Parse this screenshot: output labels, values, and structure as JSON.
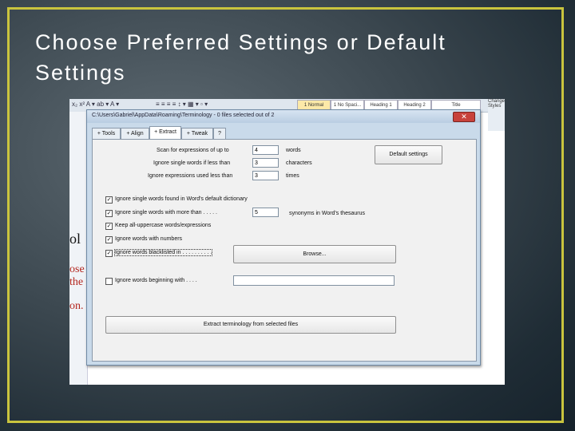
{
  "slide": {
    "title": "Choose Preferred Settings or Default Settings"
  },
  "colors": {
    "frame": "#c9c43e",
    "close": "#c8413b"
  },
  "ribbon": {
    "styles": [
      "1 Normal",
      "1 No Spaci...",
      "Heading 1",
      "Heading 2",
      "Title"
    ],
    "change_styles": "Change Styles"
  },
  "doc": {
    "fragment1": "ol",
    "fragment2": "ose",
    "fragment3": "the",
    "fragment4": "on."
  },
  "dialog": {
    "title": "C:\\Users\\Gabriel\\AppData\\Roaming\\Terminology - 0 files selected out of 2",
    "tabs": [
      "+ Tools",
      "+ Align",
      "+ Extract",
      "+ Tweak",
      "?"
    ],
    "active_tab": "+ Extract",
    "scan_label": "Scan for expressions of up to",
    "scan_value": "4",
    "scan_unit": "words",
    "ignore_single_label": "Ignore single words if less than",
    "ignore_single_value": "3",
    "ignore_single_unit": "characters",
    "ignore_expr_label": "Ignore expressions used less than",
    "ignore_expr_value": "3",
    "ignore_expr_unit": "times",
    "default_settings": "Default settings",
    "cb1": "Ignore single words found in Word's default dictionary",
    "cb2": "Ignore single words with more than . . . . .",
    "cb2_value": "5",
    "cb2_unit": "synonyms in Word's thesaurus",
    "cb3": "Keep all-uppercase words/expressions",
    "cb4": "Ignore words with numbers",
    "cb5": "Ignore words blacklisted in . . . . . . . . . .",
    "browse": "Browse...",
    "cb6": "Ignore words beginning with . . . .",
    "extract": "Extract terminology from selected files"
  }
}
